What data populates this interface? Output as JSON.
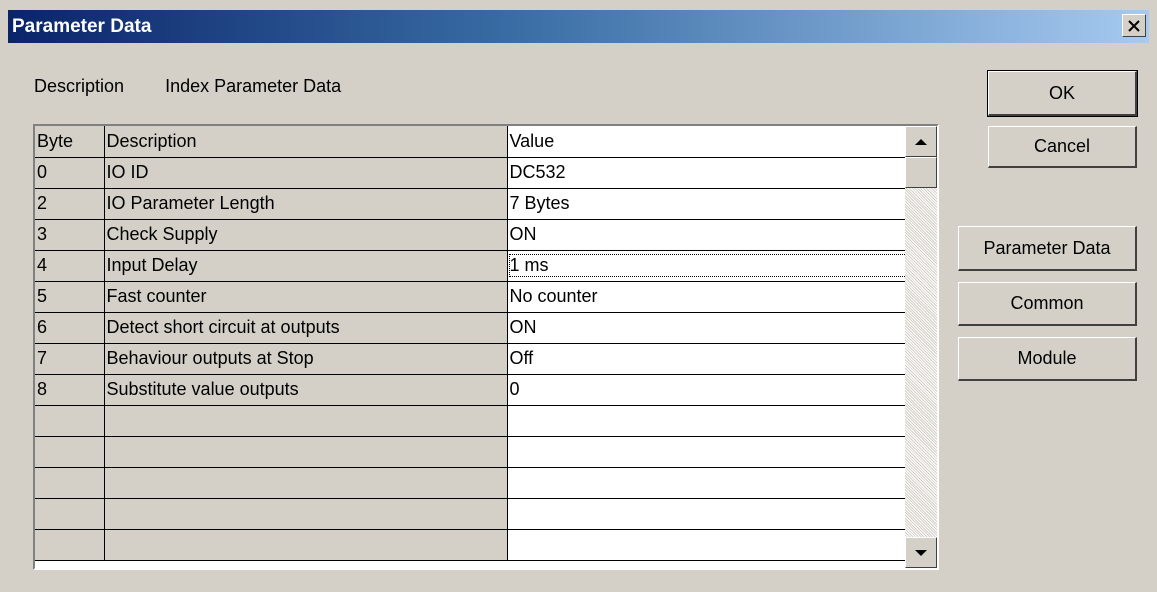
{
  "window": {
    "title": "Parameter Data"
  },
  "header": {
    "description_label": "Description",
    "index_label": "Index Parameter Data"
  },
  "grid": {
    "columns": [
      "Byte",
      "Description",
      "Value"
    ],
    "rows": [
      {
        "byte": "0",
        "description": "IO ID",
        "value": "DC532"
      },
      {
        "byte": "2",
        "description": "IO Parameter Length",
        "value": "7 Bytes"
      },
      {
        "byte": "3",
        "description": "Check Supply",
        "value": "ON"
      },
      {
        "byte": "4",
        "description": "Input Delay",
        "value": "1 ms"
      },
      {
        "byte": "5",
        "description": "Fast counter",
        "value": "No counter"
      },
      {
        "byte": "6",
        "description": "Detect short circuit at outputs",
        "value": "ON"
      },
      {
        "byte": "7",
        "description": "Behaviour outputs at Stop",
        "value": "Off"
      },
      {
        "byte": "8",
        "description": "Substitute value outputs",
        "value": "0"
      },
      {
        "byte": "",
        "description": "",
        "value": ""
      },
      {
        "byte": "",
        "description": "",
        "value": ""
      },
      {
        "byte": "",
        "description": "",
        "value": ""
      },
      {
        "byte": "",
        "description": "",
        "value": ""
      },
      {
        "byte": "",
        "description": "",
        "value": ""
      }
    ]
  },
  "buttons": {
    "ok": "OK",
    "cancel": "Cancel",
    "parameter_data": "Parameter Data",
    "common": "Common",
    "module": "Module"
  },
  "icons": {
    "close": "close-icon",
    "scroll_up": "up-arrow-icon",
    "scroll_down": "down-arrow-icon"
  }
}
